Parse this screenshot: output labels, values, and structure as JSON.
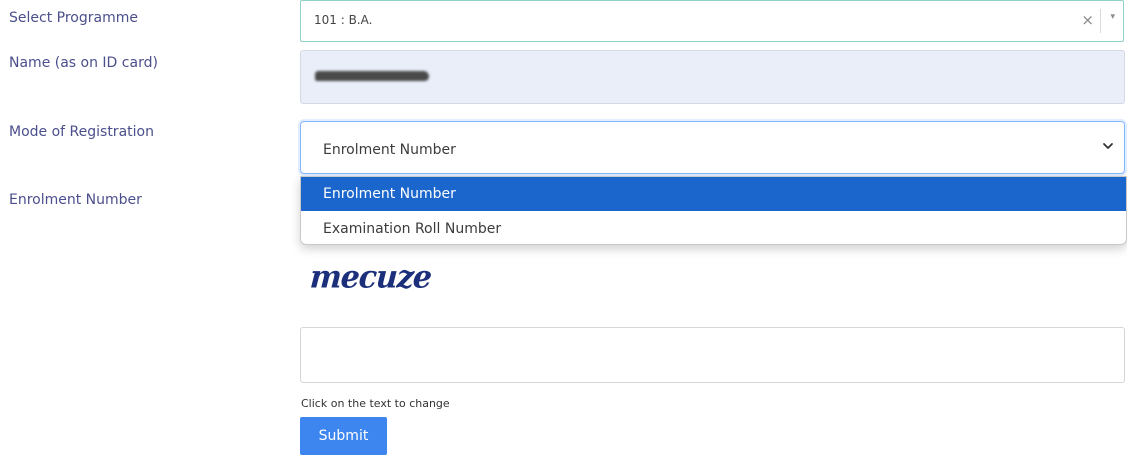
{
  "labels": {
    "programme": "Select Programme",
    "name": "Name (as on ID card)",
    "mode": "Mode of Registration",
    "enrolment": "Enrolment Number"
  },
  "programme": {
    "value": "101 : B.A.",
    "clear_icon": "×",
    "arrow_icon": "▾"
  },
  "name_field": {
    "redacted": true
  },
  "mode_select": {
    "value": "Enrolment Number",
    "options": [
      "Enrolment Number",
      "Examination Roll Number"
    ],
    "highlighted_option": "Enrolment Number"
  },
  "captcha": {
    "text": "mecuze",
    "hint": "Click on the text to change",
    "input_value": ""
  },
  "submit_label": "Submit",
  "colors": {
    "label": "#4b4f8c",
    "highlight": "#1a66cc",
    "submit": "#3d86f0",
    "readonly_bg": "#e9eef8"
  }
}
